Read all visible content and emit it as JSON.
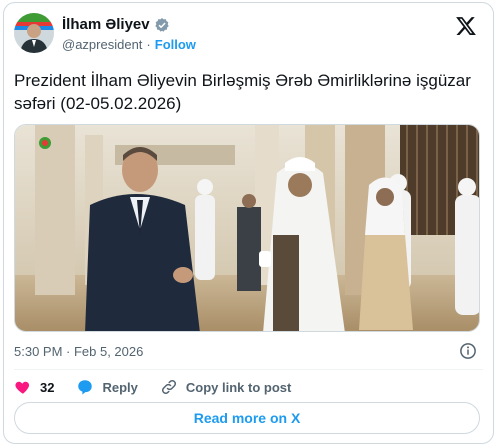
{
  "author": {
    "display_name": "İlham Əliyev",
    "handle": "@azpresident",
    "separator": "·",
    "follow_label": "Follow"
  },
  "tweet": {
    "text": "Prezident İlham Əliyevin Birləşmiş Ərəb Əmirliklərinə işgüzar səfəri (02-05.02.2026)",
    "timestamp": "5:30 PM · Feb 5, 2026"
  },
  "actions": {
    "like_count": "32",
    "reply_label": "Reply",
    "copy_link_label": "Copy link to post"
  },
  "read_more_label": "Read more on X",
  "colors": {
    "accent": "#1d9bf0",
    "like": "#f91880",
    "text": "#0f1419",
    "muted": "#536471",
    "border": "#cfd9de"
  },
  "icons": [
    "verified-badge-icon",
    "x-logo-icon",
    "info-icon",
    "heart-icon",
    "reply-icon",
    "link-icon"
  ]
}
